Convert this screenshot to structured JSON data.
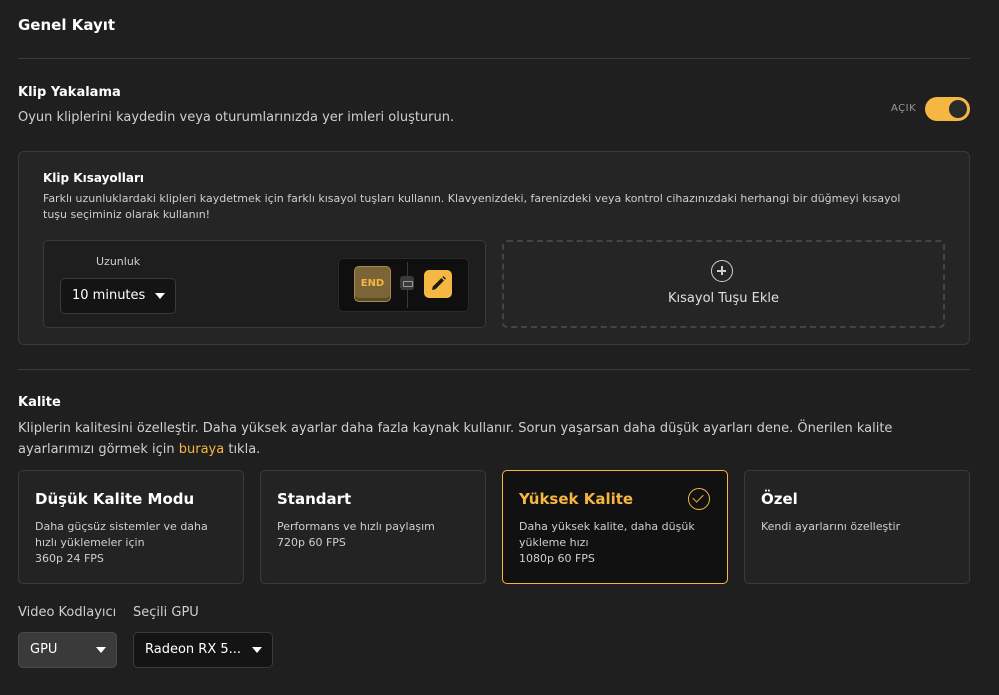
{
  "page": {
    "title": "Genel Kayıt"
  },
  "clip": {
    "title": "Klip Yakalama",
    "description": "Oyun kliplerini kaydedin veya oturumlarınızda yer imleri oluşturun.",
    "toggle_label": "AÇIK",
    "toggle_on": true
  },
  "shortcuts": {
    "title": "Klip Kısayolları",
    "description": "Farklı uzunluklardaki klipleri kaydetmek için farklı kısayol tuşları kullanın. Klavyenizdeki, farenizdeki veya kontrol cihazınızdaki herhangi bir düğmeyi kısayol tuşu seçiminiz olarak kullanın!",
    "duration_label": "Uzunluk",
    "duration_value": "10 minutes",
    "key": "END",
    "add_label": "Kısayol Tuşu Ekle"
  },
  "quality": {
    "title": "Kalite",
    "desc_before": "Kliplerin kalitesini özelleştir. Daha yüksek ayarlar daha fazla kaynak kullanır. Sorun yaşarsan daha düşük ayarları dene. Önerilen kalite ayarlarımızı görmek için ",
    "desc_link": "buraya",
    "desc_after": " tıkla.",
    "options": [
      {
        "title": "Düşük Kalite Modu",
        "description": "Daha güçsüz sistemler ve daha hızlı yüklemeler için",
        "spec": "360p 24 FPS"
      },
      {
        "title": "Standart",
        "description": "Performans ve hızlı paylaşım",
        "spec": "720p 60 FPS"
      },
      {
        "title": "Yüksek Kalite",
        "description": "Daha yüksek kalite, daha düşük yükleme hızı",
        "spec": "1080p 60 FPS",
        "selected": true
      },
      {
        "title": "Özel",
        "description": "Kendi ayarlarını özelleştir",
        "spec": ""
      }
    ]
  },
  "encoder": {
    "label": "Video Kodlayıcı",
    "value": "GPU"
  },
  "gpu": {
    "label": "Seçili GPU",
    "value": "Radeon RX 5..."
  },
  "colors": {
    "accent": "#f5b642",
    "background": "#1f1f1f"
  }
}
